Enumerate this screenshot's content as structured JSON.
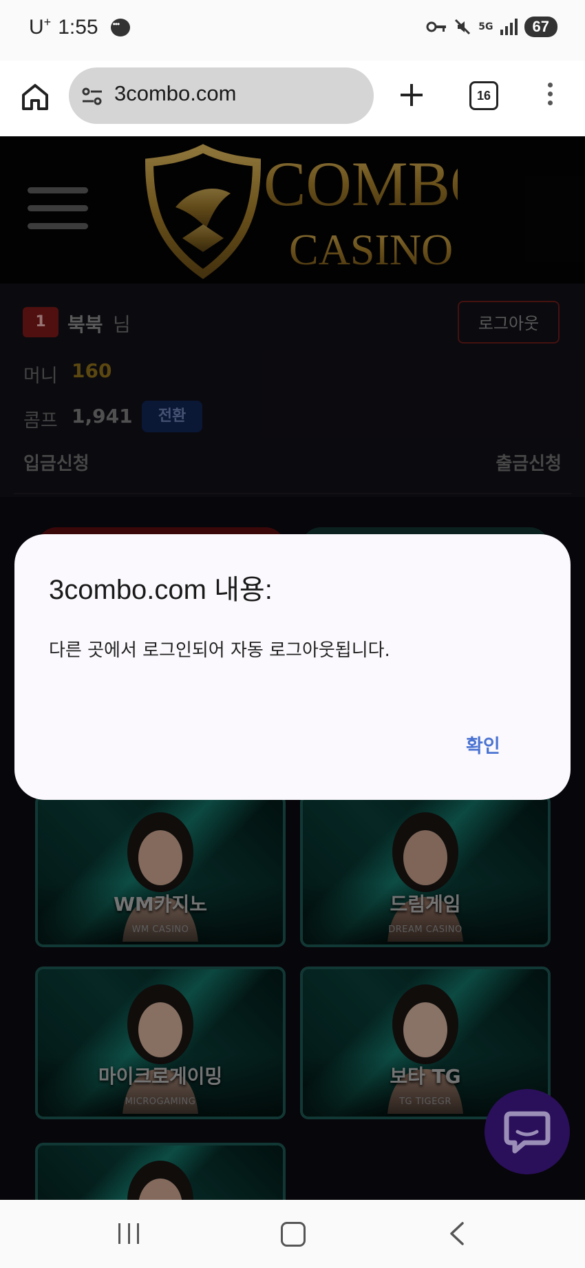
{
  "status_bar": {
    "carrier": "U",
    "carrier_sup": "+",
    "time": "1:55",
    "network": "5G",
    "battery": "67"
  },
  "browser": {
    "url": "3combo.com",
    "tab_count": "16"
  },
  "header": {
    "logo_line1": "COMBO",
    "logo_line2": "CASINO"
  },
  "user": {
    "level": "1",
    "name": "북북",
    "suffix": "님",
    "logout_label": "로그아웃",
    "money_label": "머니",
    "money_value": "160",
    "comp_label": "콤프",
    "comp_value": "1,941",
    "convert_label": "전환",
    "deposit_label": "입금신청",
    "withdraw_label": "출금신청"
  },
  "games": [
    {
      "name_ko": "WM카지노",
      "name_en": "WM CASINO"
    },
    {
      "name_ko": "드림게임",
      "name_en": "DREAM CASINO"
    },
    {
      "name_ko": "마이크로게이밍",
      "name_en": "MICROGAMING"
    },
    {
      "name_ko": "보타 TG",
      "name_en": "TG TIGEGR"
    }
  ],
  "dialog": {
    "title": "3combo.com 내용:",
    "message": "다른 곳에서 로그인되어 자동 로그아웃됩니다.",
    "ok_label": "확인"
  },
  "colors": {
    "accent_gold": "#b8902b",
    "dialog_button": "#4a73d2",
    "card_border": "#1c5752"
  }
}
